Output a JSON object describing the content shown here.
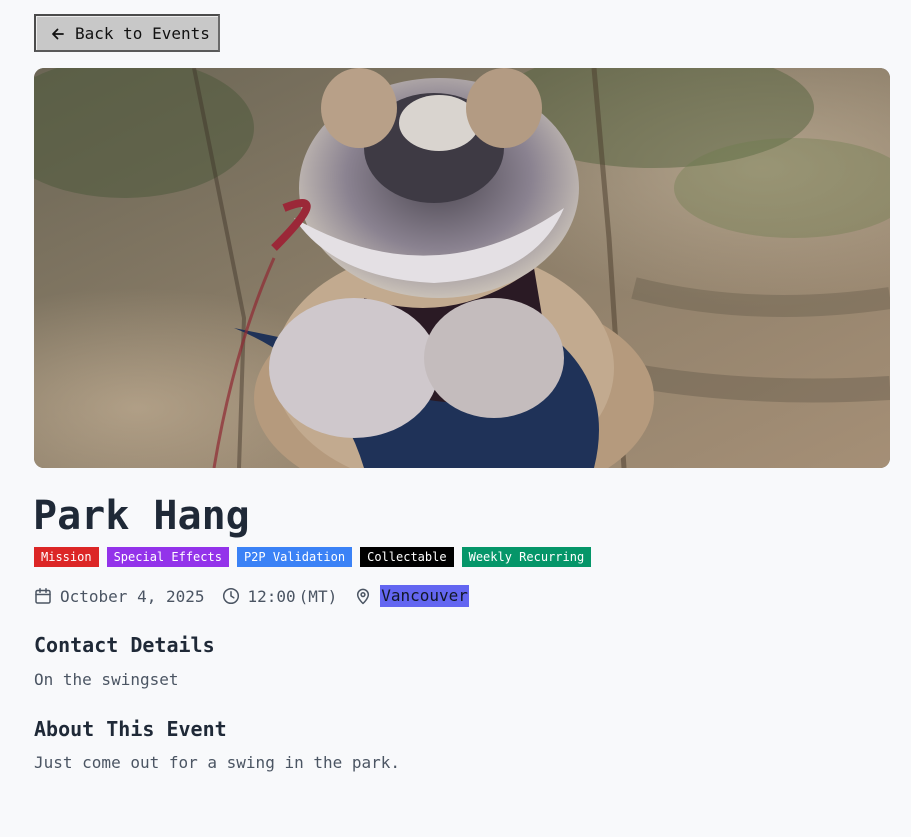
{
  "back_button": {
    "label": "Back to Events",
    "icon": "arrow-left-icon"
  },
  "hero_image": {
    "alt": "Bulldog in a harness sitting in a park",
    "description_colors": {
      "ground": "#8a7b66",
      "dog_fur": "#d8d4cf",
      "harness": "#1f3560"
    }
  },
  "event": {
    "title": "Park Hang",
    "tags": [
      {
        "label": "Mission",
        "color": "#dc2626"
      },
      {
        "label": "Special Effects",
        "color": "#9333ea"
      },
      {
        "label": "P2P Validation",
        "color": "#3b82f6"
      },
      {
        "label": "Collectable",
        "color": "#000000"
      },
      {
        "label": "Weekly Recurring",
        "color": "#059669"
      }
    ],
    "date": "October 4, 2025",
    "time": "12:00",
    "timezone": "(MT)",
    "location": "Vancouver"
  },
  "contact": {
    "heading": "Contact Details",
    "text": "On the swingset"
  },
  "about": {
    "heading": "About This Event",
    "text": "Just come out for a swing in the park."
  },
  "colors": {
    "background": "#f8f9fb",
    "title": "#1f2937",
    "body_text": "#4b5563",
    "location_highlight": "#6366f1"
  }
}
